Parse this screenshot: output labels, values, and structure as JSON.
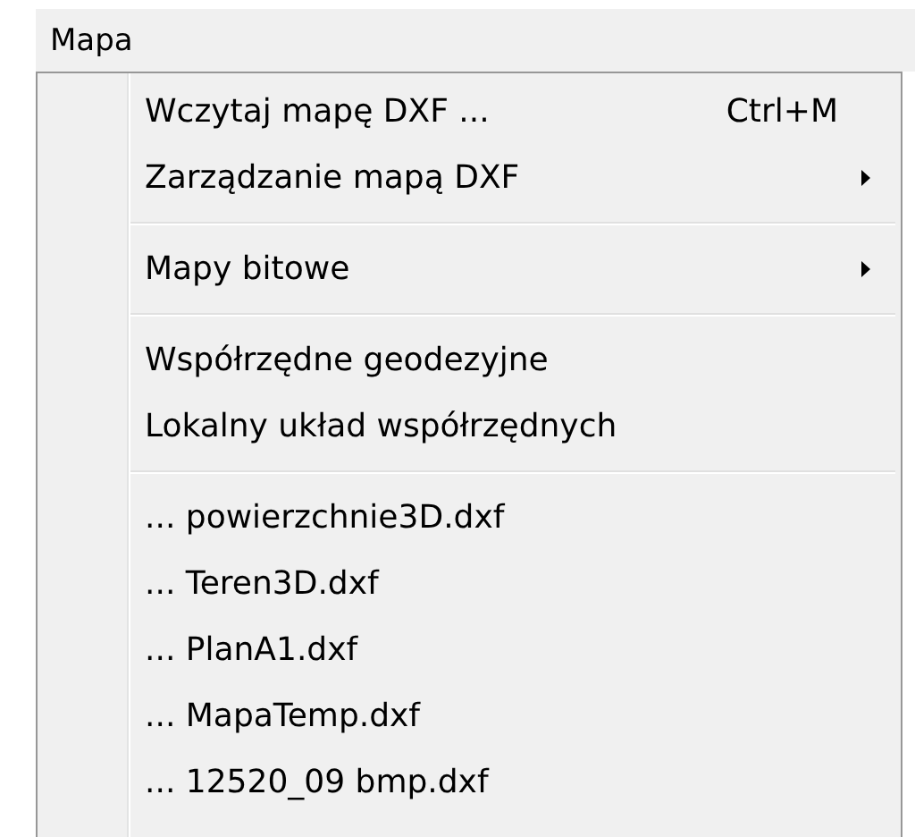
{
  "menu_bar": [
    {
      "label": "Mapa"
    }
  ],
  "menu": {
    "items": [
      {
        "kind": "item",
        "label": "Wczytaj mapę DXF ...",
        "shortcut": "Ctrl+M",
        "submenu": false
      },
      {
        "kind": "item",
        "label": "Zarządzanie mapą DXF",
        "submenu": true
      },
      {
        "kind": "separator"
      },
      {
        "kind": "item",
        "label": "Mapy bitowe",
        "submenu": true
      },
      {
        "kind": "separator"
      },
      {
        "kind": "item",
        "label": "Współrzędne geodezyjne",
        "submenu": false
      },
      {
        "kind": "item",
        "label": "Lokalny układ współrzędnych",
        "submenu": false
      },
      {
        "kind": "separator"
      },
      {
        "kind": "item",
        "label": "... powierzchnie3D.dxf",
        "submenu": false
      },
      {
        "kind": "item",
        "label": "... Teren3D.dxf",
        "submenu": false
      },
      {
        "kind": "item",
        "label": "... PlanA1.dxf",
        "submenu": false
      },
      {
        "kind": "item",
        "label": "... MapaTemp.dxf",
        "submenu": false
      },
      {
        "kind": "item",
        "label": "... 12520_09 bmp.dxf",
        "submenu": false
      }
    ]
  }
}
